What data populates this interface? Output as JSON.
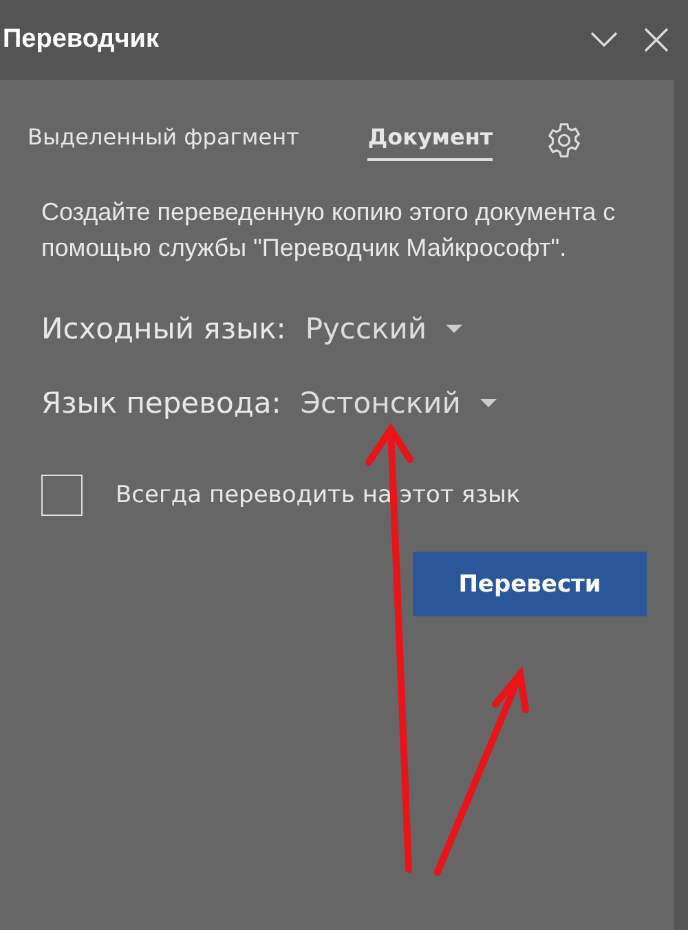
{
  "window": {
    "title": "Переводчик"
  },
  "tabs": [
    {
      "label": "Выделенный фрагмент",
      "selected": false
    },
    {
      "label": "Документ",
      "selected": true
    }
  ],
  "description": "Создайте переведенную копию этого документа с помощью службы \"Переводчик Майкрософт\".",
  "languages": [
    {
      "label": "Исходный язык:",
      "value": "Русский"
    },
    {
      "label": "Язык перевода:",
      "value": "Эстонский"
    }
  ],
  "always_translate": {
    "label": "Всегда переводить на этот язык",
    "checked": false
  },
  "translate_button": "Перевести"
}
